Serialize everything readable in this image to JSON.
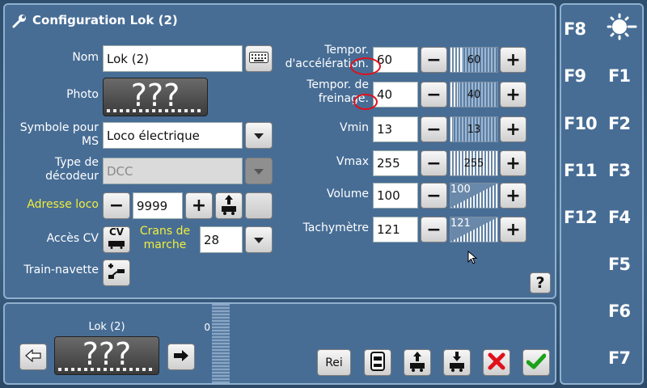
{
  "title": "Configuration Lok (2)",
  "form": {
    "nom_label": "Nom",
    "nom_value": "Lok (2)",
    "photo_label": "Photo",
    "photo_placeholder": "???",
    "symbole_label": "Symbole pour MS",
    "symbole_value": "Loco électrique",
    "decodeur_label": "Type de décodeur",
    "decodeur_value": "DCC",
    "adresse_label": "Adresse loco",
    "adresse_value": "9999",
    "acces_cv_label": "Accès CV",
    "cv_button": "CV",
    "crans_label": "Crans de marche",
    "crans_value": "28",
    "train_navette_label": "Train-navette"
  },
  "settings": [
    {
      "label": "Tempor. d'accélération.",
      "value": "60",
      "slider": "60"
    },
    {
      "label": "Tempor. de freinage.",
      "value": "40",
      "slider": "40"
    },
    {
      "label": "Vmin",
      "value": "13",
      "slider": "13"
    },
    {
      "label": "Vmax",
      "value": "255",
      "slider": "255"
    },
    {
      "label": "Volume",
      "value": "100",
      "slider": "100"
    },
    {
      "label": "Tachymètre",
      "value": "121",
      "slider": "121"
    }
  ],
  "slider_fraction": [
    0.24,
    0.16,
    0.05,
    1.0,
    0.39,
    0.47
  ],
  "help_button": "?",
  "bottom": {
    "loco_name": "Lok (2)",
    "loco_placeholder": "???",
    "speed_value": "0",
    "rei_button": "Rei"
  },
  "function_keys": {
    "f0": "F0",
    "f1": "F1",
    "f2": "F2",
    "f3": "F3",
    "f4": "F4",
    "f5": "F5",
    "f6": "F6",
    "f7": "F7",
    "f8": "F8",
    "f9": "F9",
    "f10": "F10",
    "f11": "F11",
    "f12": "F12"
  },
  "colors": {
    "accent_yellow": "#f1ee3a",
    "panel_blue": "#476d95",
    "cancel_red": "#e0101a",
    "confirm_green": "#1aa31a"
  }
}
